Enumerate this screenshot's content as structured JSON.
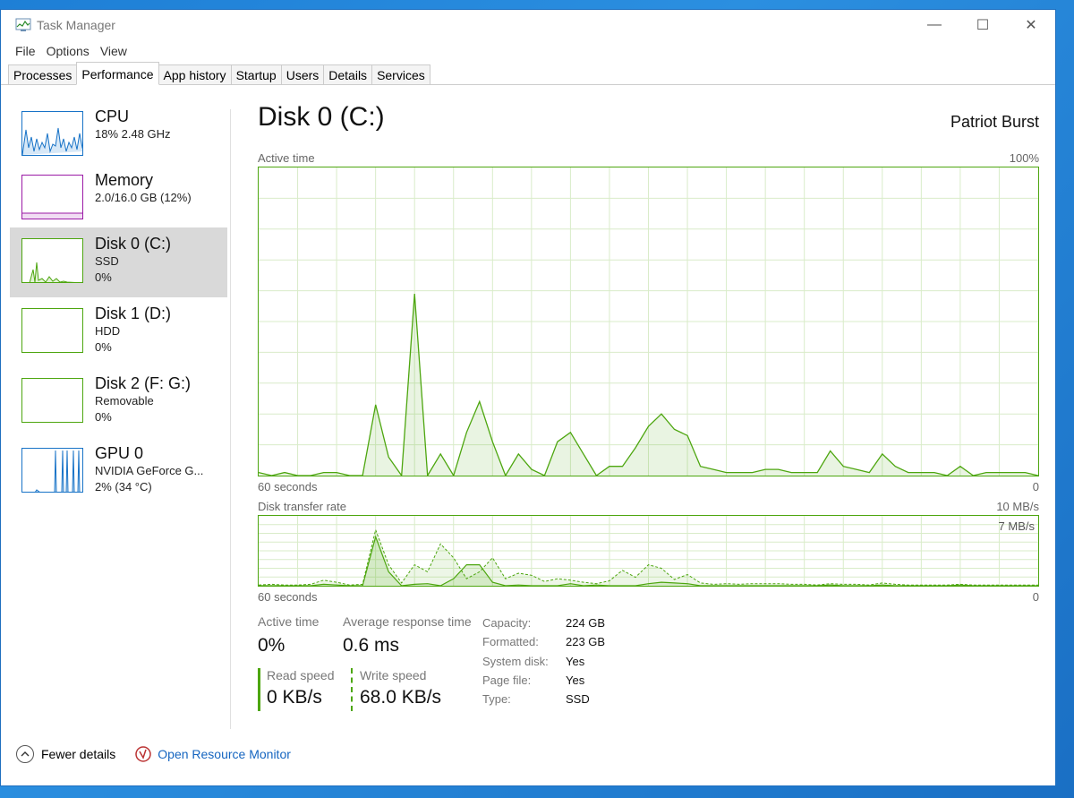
{
  "window": {
    "title": "Task Manager"
  },
  "menu": [
    "File",
    "Options",
    "View"
  ],
  "tabs": [
    "Processes",
    "Performance",
    "App history",
    "Startup",
    "Users",
    "Details",
    "Services"
  ],
  "active_tab": "Performance",
  "sidebar": {
    "items": [
      {
        "name": "CPU",
        "line1": "18%  2.48 GHz",
        "line2": "",
        "color": "#1873c7"
      },
      {
        "name": "Memory",
        "line1": "2.0/16.0 GB (12%)",
        "line2": "",
        "color": "#9b1aa6"
      },
      {
        "name": "Disk 0 (C:)",
        "line1": "SSD",
        "line2": "0%",
        "color": "#4da60f"
      },
      {
        "name": "Disk 1 (D:)",
        "line1": "HDD",
        "line2": "0%",
        "color": "#4da60f"
      },
      {
        "name": "Disk 2 (F: G:)",
        "line1": "Removable",
        "line2": "0%",
        "color": "#4da60f"
      },
      {
        "name": "GPU 0",
        "line1": "NVIDIA GeForce G...",
        "line2": "2% (34 °C)",
        "color": "#1873c7"
      }
    ]
  },
  "main": {
    "title": "Disk 0 (C:)",
    "model": "Patriot Burst",
    "active_chart": {
      "label": "Active time",
      "max_label": "100%",
      "time_label": "60 seconds",
      "zero_label": "0"
    },
    "transfer_chart": {
      "label": "Disk transfer rate",
      "max_label": "10 MB/s",
      "inner_label": "7 MB/s",
      "time_label": "60 seconds",
      "zero_label": "0"
    }
  },
  "stats": {
    "active_time_label": "Active time",
    "active_time": "0%",
    "avg_response_label": "Average response time",
    "avg_response": "0.6 ms",
    "read_label": "Read speed",
    "read": "0 KB/s",
    "write_label": "Write speed",
    "write": "68.0 KB/s"
  },
  "properties": [
    {
      "k": "Capacity:",
      "v": "224 GB"
    },
    {
      "k": "Formatted:",
      "v": "223 GB"
    },
    {
      "k": "System disk:",
      "v": "Yes"
    },
    {
      "k": "Page file:",
      "v": "Yes"
    },
    {
      "k": "Type:",
      "v": "SSD"
    }
  ],
  "footer": {
    "fewer": "Fewer details",
    "monitor": "Open Resource Monitor"
  },
  "chart_data": [
    {
      "type": "area",
      "title": "Active time",
      "ylim": [
        0,
        100
      ],
      "x": [
        60,
        59,
        58,
        57,
        56,
        55,
        54,
        53,
        52,
        51,
        50,
        49,
        48,
        47,
        46,
        45,
        44,
        43,
        42,
        41,
        40,
        39,
        38,
        37,
        36,
        35,
        34,
        33,
        32,
        31,
        30,
        29,
        28,
        27,
        26,
        25,
        24,
        23,
        22,
        21,
        20,
        19,
        18,
        17,
        16,
        15,
        14,
        13,
        12,
        11,
        10,
        9,
        8,
        7,
        6,
        5,
        4,
        3,
        2,
        1,
        0
      ],
      "values": [
        1,
        0,
        1,
        0,
        0,
        1,
        1,
        0,
        0,
        23,
        6,
        0,
        59,
        0,
        7,
        0,
        14,
        24,
        11,
        0,
        7,
        2,
        0,
        11,
        14,
        7,
        0,
        3,
        3,
        9,
        16,
        20,
        15,
        13,
        3,
        2,
        1,
        1,
        1,
        2,
        2,
        1,
        1,
        1,
        8,
        3,
        2,
        1,
        7,
        3,
        1,
        1,
        1,
        0,
        3,
        0,
        1,
        1,
        1,
        1,
        0
      ]
    },
    {
      "type": "area",
      "title": "Disk transfer rate",
      "ylim": [
        0,
        10
      ],
      "series": [
        {
          "name": "Read speed",
          "values": [
            0,
            0,
            0,
            0,
            0,
            0.2,
            0.1,
            0,
            0,
            7,
            2,
            0,
            0.2,
            0.3,
            0,
            1,
            3,
            3,
            0.5,
            0,
            0.1,
            0,
            0,
            0,
            0.3,
            0,
            0.1,
            0,
            0,
            0,
            0.3,
            0.5,
            0.4,
            0.3,
            0,
            0,
            0,
            0,
            0,
            0,
            0,
            0,
            0,
            0,
            0.1,
            0,
            0,
            0,
            0.1,
            0,
            0,
            0,
            0,
            0,
            0.1,
            0,
            0,
            0,
            0,
            0,
            0
          ]
        },
        {
          "name": "Write speed",
          "values": [
            0.1,
            0.2,
            0.1,
            0.1,
            0.2,
            0.8,
            0.5,
            0.1,
            0.2,
            8,
            3,
            0.4,
            3,
            2,
            6,
            4,
            1,
            2,
            4,
            1,
            1.8,
            1.5,
            0.6,
            1,
            0.8,
            0.5,
            0.3,
            0.7,
            2.2,
            1.2,
            3,
            2.5,
            0.9,
            1.6,
            0.4,
            0.2,
            0.3,
            0.2,
            0.3,
            0.3,
            0.3,
            0.2,
            0.2,
            0.1,
            0.3,
            0.2,
            0.2,
            0.1,
            0.4,
            0.2,
            0.1,
            0.1,
            0.1,
            0.1,
            0.2,
            0.1,
            0.1,
            0.1,
            0.1,
            0.1,
            0.1
          ]
        }
      ]
    }
  ]
}
